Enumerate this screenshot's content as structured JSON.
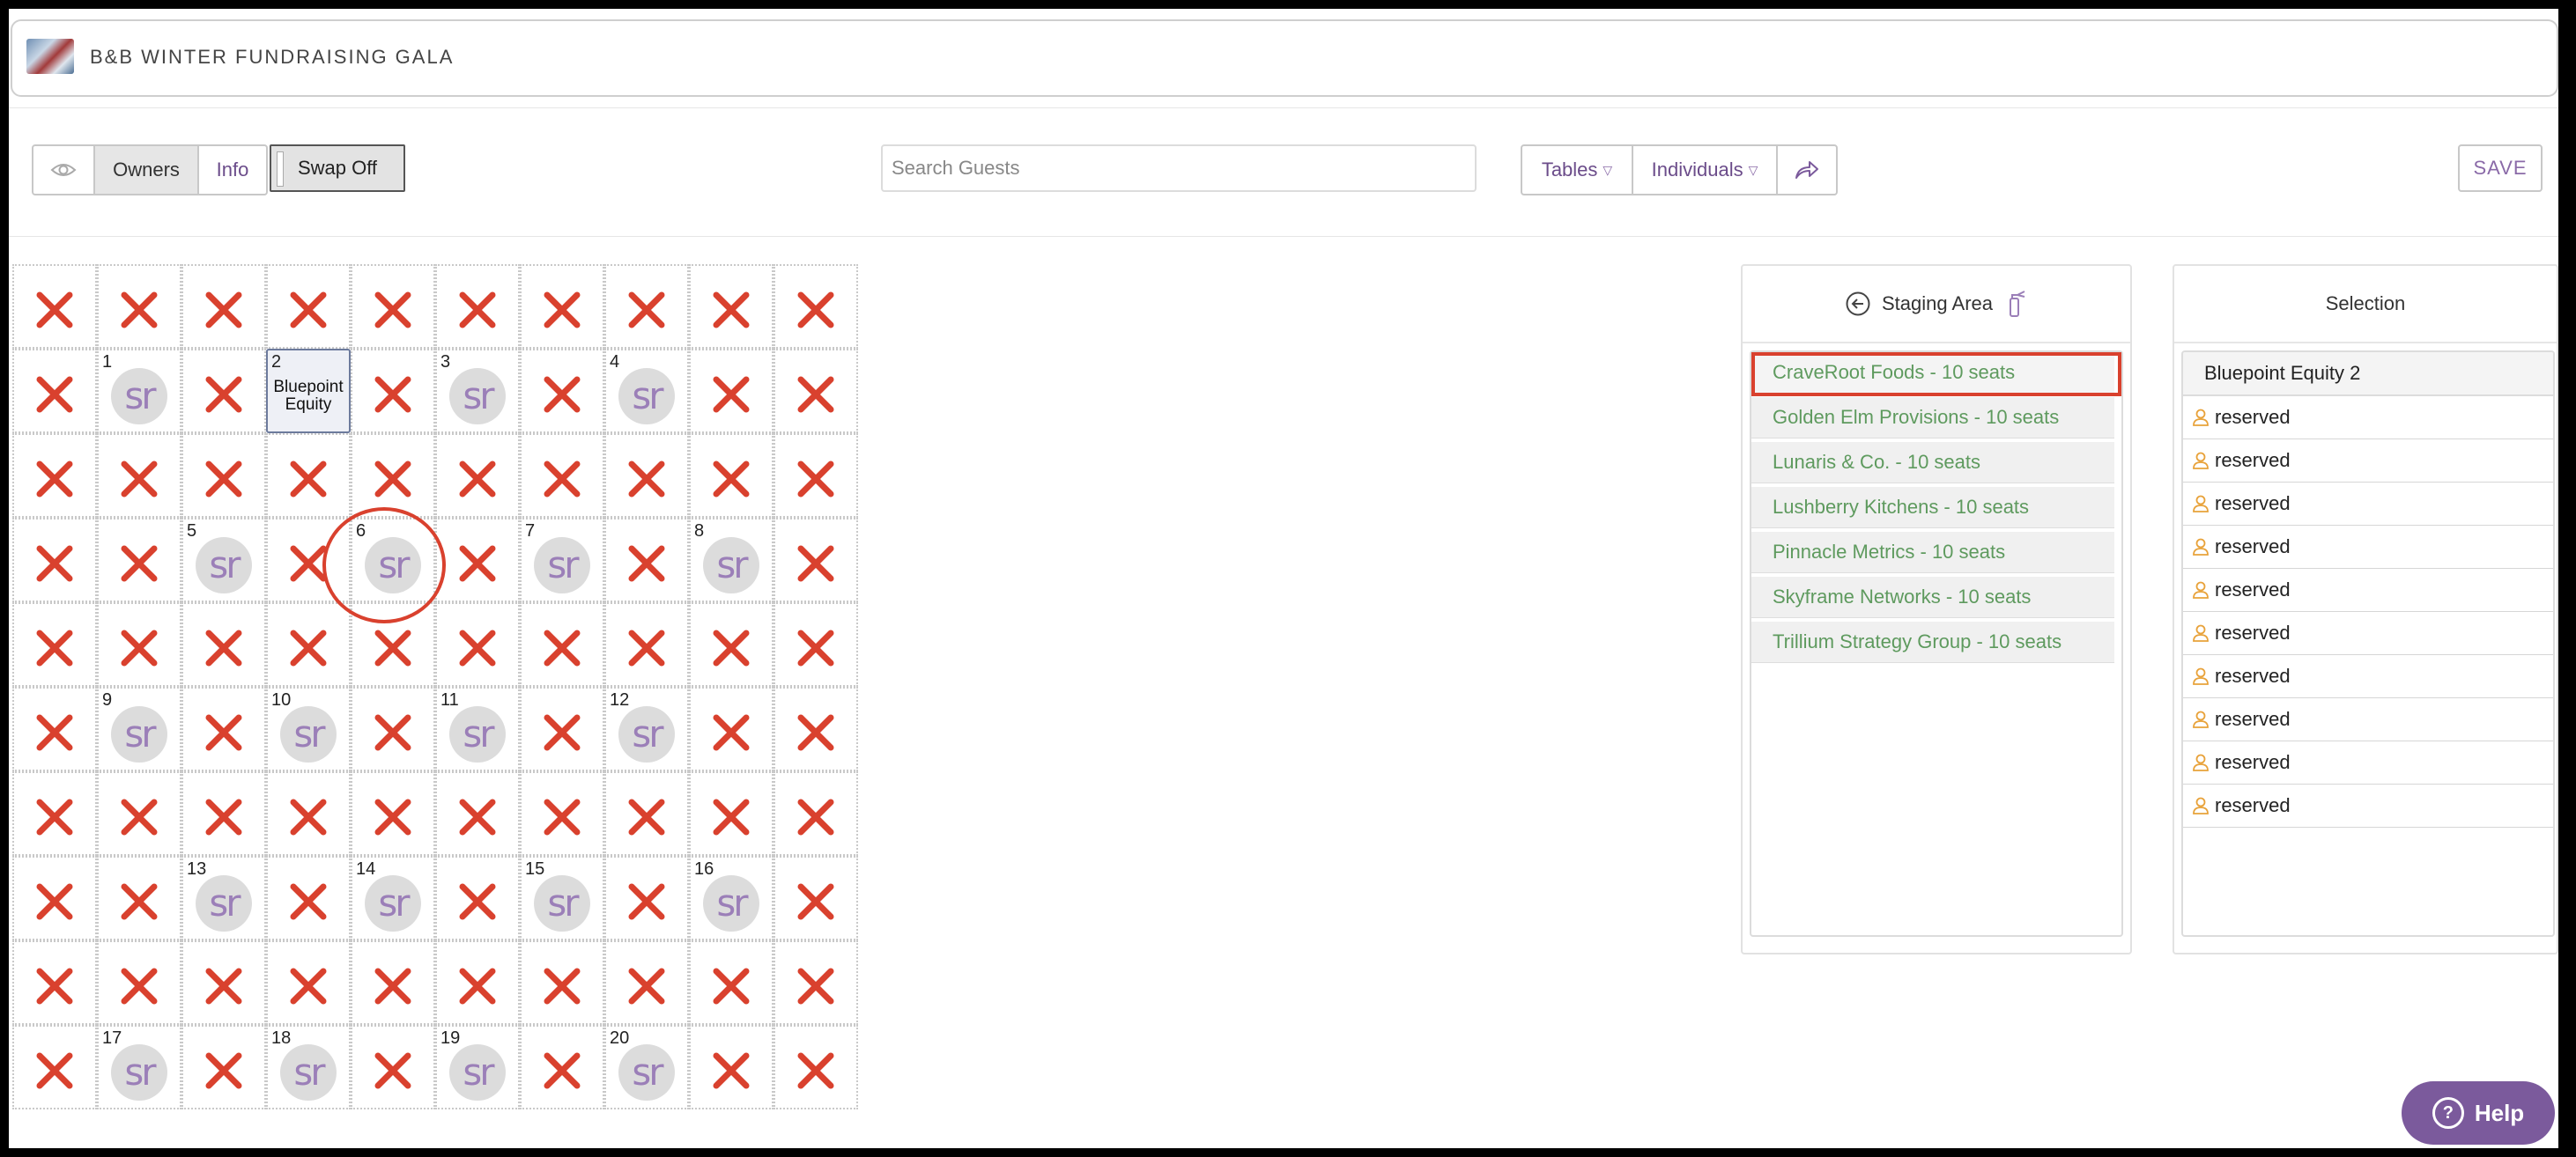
{
  "header": {
    "event_title": "B&B WINTER FUNDRAISING GALA"
  },
  "toolbar": {
    "owners_label": "Owners",
    "info_label": "Info",
    "swap_label": "Swap Off",
    "search_placeholder": "Search Guests",
    "tables_label": "Tables",
    "individuals_label": "Individuals",
    "save_label": "SAVE"
  },
  "grid": {
    "columns": 10,
    "rows": 10,
    "tables": [
      {
        "number": "1",
        "row": 1,
        "col": 1,
        "badge": "sr"
      },
      {
        "number": "2",
        "row": 1,
        "col": 3,
        "name": "Bluepoint Equity"
      },
      {
        "number": "3",
        "row": 1,
        "col": 5,
        "badge": "sr"
      },
      {
        "number": "4",
        "row": 1,
        "col": 7,
        "badge": "sr"
      },
      {
        "number": "5",
        "row": 3,
        "col": 2,
        "badge": "sr"
      },
      {
        "number": "6",
        "row": 3,
        "col": 4,
        "badge": "sr"
      },
      {
        "number": "7",
        "row": 3,
        "col": 6,
        "badge": "sr"
      },
      {
        "number": "8",
        "row": 3,
        "col": 8,
        "badge": "sr"
      },
      {
        "number": "9",
        "row": 5,
        "col": 1,
        "badge": "sr"
      },
      {
        "number": "10",
        "row": 5,
        "col": 3,
        "badge": "sr"
      },
      {
        "number": "11",
        "row": 5,
        "col": 5,
        "badge": "sr"
      },
      {
        "number": "12",
        "row": 5,
        "col": 7,
        "badge": "sr"
      },
      {
        "number": "13",
        "row": 7,
        "col": 2,
        "badge": "sr"
      },
      {
        "number": "14",
        "row": 7,
        "col": 4,
        "badge": "sr"
      },
      {
        "number": "15",
        "row": 7,
        "col": 6,
        "badge": "sr"
      },
      {
        "number": "16",
        "row": 7,
        "col": 8,
        "badge": "sr"
      },
      {
        "number": "17",
        "row": 9,
        "col": 1,
        "badge": "sr"
      },
      {
        "number": "18",
        "row": 9,
        "col": 3,
        "badge": "sr"
      },
      {
        "number": "19",
        "row": 9,
        "col": 5,
        "badge": "sr"
      },
      {
        "number": "20",
        "row": 9,
        "col": 7,
        "badge": "sr"
      }
    ]
  },
  "staging": {
    "title": "Staging Area",
    "items": [
      "CraveRoot Foods - 10 seats",
      "Golden Elm Provisions - 10 seats",
      "Lunaris & Co. - 10 seats",
      "Lushberry Kitchens - 10 seats",
      "Pinnacle Metrics - 10 seats",
      "Skyframe Networks - 10 seats",
      "Trillium Strategy Group - 10 seats"
    ]
  },
  "selection": {
    "title": "Selection",
    "table_name": "Bluepoint Equity 2",
    "seats": [
      "reserved",
      "reserved",
      "reserved",
      "reserved",
      "reserved",
      "reserved",
      "reserved",
      "reserved",
      "reserved",
      "reserved"
    ]
  },
  "help": {
    "label": "Help"
  },
  "colors": {
    "accent": "#7b5a9c",
    "blocked": "#d9412e",
    "staging_text": "#5e9a5e"
  }
}
